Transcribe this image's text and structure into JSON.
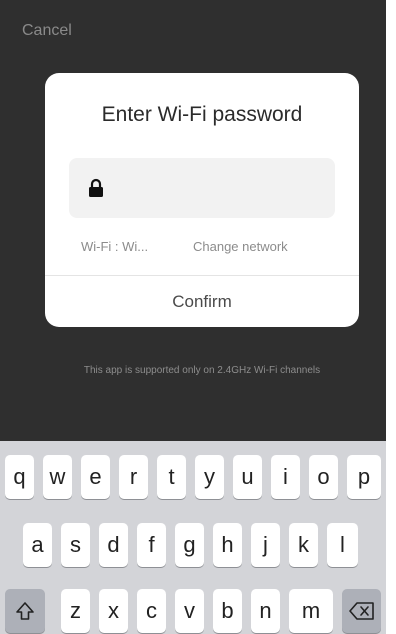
{
  "header": {
    "cancel_label": "Cancel"
  },
  "dialog": {
    "title": "Enter Wi-Fi password",
    "password_icon": "lock-icon",
    "network_label": "Wi-Fi : Wi...",
    "change_network_label": "Change network",
    "confirm_label": "Confirm"
  },
  "note": "This app is supported only on 2.4GHz Wi-Fi channels",
  "keyboard": {
    "row1": [
      "q",
      "w",
      "e",
      "r",
      "t",
      "y",
      "u",
      "i",
      "o",
      "p"
    ],
    "row2": [
      "a",
      "s",
      "d",
      "f",
      "g",
      "h",
      "j",
      "k",
      "l"
    ],
    "row3": [
      "z",
      "x",
      "c",
      "v",
      "b",
      "n",
      "m"
    ],
    "shift_icon": "shift-icon",
    "backspace_icon": "backspace-icon"
  },
  "colors": {
    "overlay": "#2f2f2f",
    "dialog_bg": "#ffffff",
    "field_bg": "#f2f2f2",
    "keyboard_bg": "#d3d4d8",
    "key_bg": "#ffffff",
    "special_key_bg": "#adb0b8"
  }
}
